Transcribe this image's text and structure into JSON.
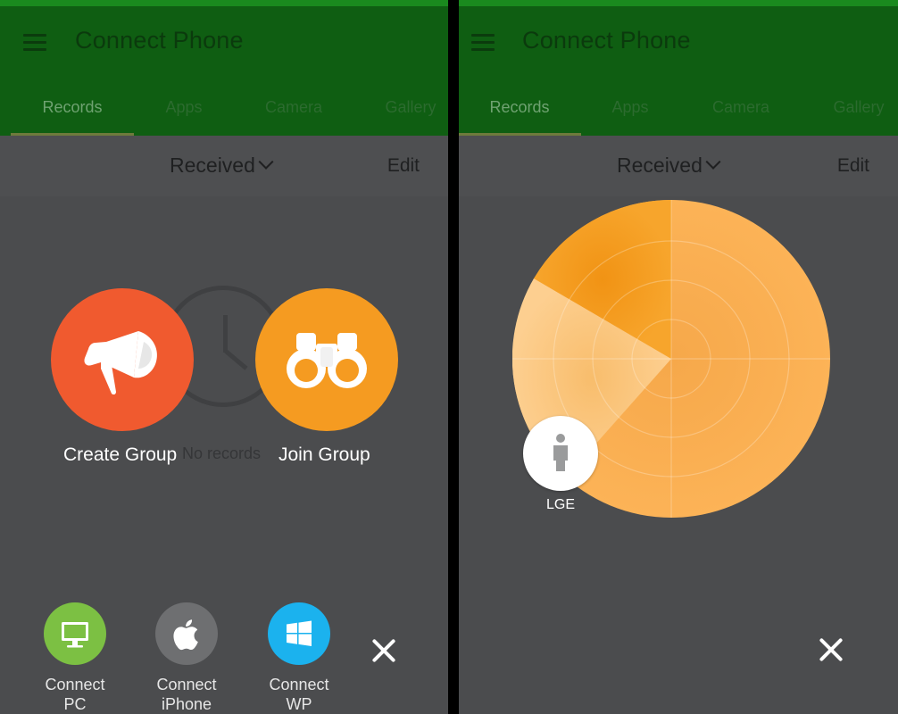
{
  "screens": [
    {
      "app_title": "Connect Phone",
      "tabs": [
        "Records",
        "Apps",
        "Camera",
        "Gallery"
      ],
      "active_tab": "Records",
      "filter_label": "Received",
      "edit_label": "Edit",
      "empty_text": "No records",
      "create_group_label": "Create Group",
      "join_group_label": "Join Group",
      "connect_pc_label": [
        "Connect",
        "PC"
      ],
      "connect_iphone_label": [
        "Connect",
        "iPhone"
      ],
      "connect_wp_label": [
        "Connect",
        "WP"
      ],
      "icons": [
        "menu-icon",
        "chevron-down-icon",
        "clock-icon",
        "megaphone-icon",
        "binoculars-icon",
        "monitor-icon",
        "apple-icon",
        "windows-icon",
        "close-icon"
      ]
    },
    {
      "app_title": "Connect Phone",
      "tabs": [
        "Records",
        "Apps",
        "Camera",
        "Gallery"
      ],
      "active_tab": "Records",
      "filter_label": "Received",
      "edit_label": "Edit",
      "nearby_device_label": "LGE",
      "icons": [
        "menu-icon",
        "chevron-down-icon",
        "radar-icon",
        "person-icon",
        "close-icon"
      ]
    }
  ],
  "colors": {
    "app_bar_dimmed": "#0f5e12",
    "create_group": "#f05a2f",
    "join_group": "#f59b21",
    "connect_pc": "#7cc043",
    "connect_iphone": "#6e6f71",
    "connect_wp": "#1bb2ee",
    "radar_orange": "#f9a93f",
    "overlay_bg": "#4b4c4e"
  }
}
